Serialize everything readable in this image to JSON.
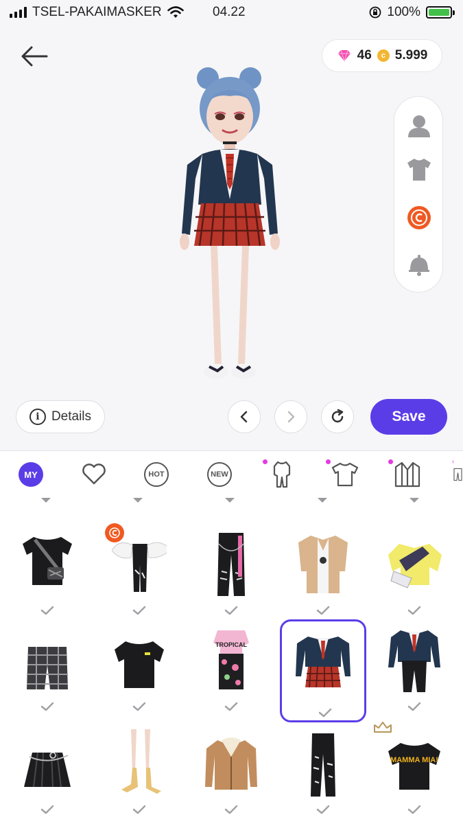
{
  "status_bar": {
    "carrier": "TSEL-PAKAIMASKER",
    "time": "04.22",
    "battery_percent": "100%"
  },
  "header": {
    "gems": "46",
    "coins": "5.999"
  },
  "coin_symbol": "c",
  "controls": {
    "details_label": "Details",
    "save_label": "Save"
  },
  "side_panel": [
    "person-icon",
    "tshirt-icon",
    "coin-icon",
    "bell-icon"
  ],
  "tabs": [
    {
      "name": "my",
      "label": "MY",
      "active": true
    },
    {
      "name": "favorites",
      "icon": "heart-icon"
    },
    {
      "name": "hot",
      "label": "HOT"
    },
    {
      "name": "new",
      "label": "NEW"
    },
    {
      "name": "bodysuit",
      "icon": "bodysuit-icon",
      "dot": true
    },
    {
      "name": "tops",
      "icon": "tshirt-icon",
      "dot": true
    },
    {
      "name": "outerwear",
      "icon": "jacket-icon",
      "dot": true
    },
    {
      "name": "bottoms",
      "icon": "pants-icon",
      "dot": true
    }
  ],
  "mini_labels": {
    "tropical": "TROPICAL",
    "mamma_mia": "MAMMA MIA!"
  },
  "items": [
    {
      "name": "black-tee-camo-bag",
      "row": 0,
      "col": 0
    },
    {
      "name": "white-gloves-black-pants",
      "row": 0,
      "col": 1,
      "badge": "coin"
    },
    {
      "name": "black-ripped-chain-pants",
      "row": 0,
      "col": 2
    },
    {
      "name": "tan-open-shirt",
      "row": 0,
      "col": 3
    },
    {
      "name": "yellow-jacket-bag",
      "row": 0,
      "col": 4
    },
    {
      "name": "plaid-shorts",
      "row": 1,
      "col": 0
    },
    {
      "name": "black-tee",
      "row": 1,
      "col": 1
    },
    {
      "name": "tropical-dress",
      "row": 1,
      "col": 2
    },
    {
      "name": "school-uniform-skirt",
      "row": 1,
      "col": 3,
      "selected": true
    },
    {
      "name": "school-uniform-pants",
      "row": 1,
      "col": 4
    },
    {
      "name": "black-pleated-skirt",
      "row": 2,
      "col": 0
    },
    {
      "name": "yellow-socks",
      "row": 2,
      "col": 1
    },
    {
      "name": "shearling-jacket",
      "row": 2,
      "col": 2
    },
    {
      "name": "ripped-black-jeans",
      "row": 2,
      "col": 3
    },
    {
      "name": "mamma-mia-tee",
      "row": 2,
      "col": 4,
      "badge": "crown"
    }
  ],
  "colors": {
    "accent": "#5b3de8",
    "dot": "#e53be0",
    "coin_orange": "#ef5a22",
    "coin_gold": "#f3b632"
  }
}
